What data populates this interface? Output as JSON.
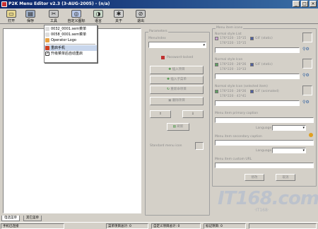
{
  "window": {
    "title": "P2K Menu Editor v2.3 (3-AUG-2005) - (n/a)",
    "min": "_",
    "max": "□",
    "close": "×"
  },
  "toolbar": {
    "open": "打开",
    "save": "保存",
    "tools": "工具",
    "custom_icon": "自定义图标",
    "language": "语言",
    "about": "关于",
    "exit": "退出"
  },
  "tools_menu": {
    "items": [
      "0032_0001.sem菜单",
      "0058_0001.sem菜单",
      "Operator Logo",
      "重启手机",
      "升级菜单后自动重启"
    ]
  },
  "params": {
    "title": "Parameters",
    "menu_index": "MenuIndex",
    "password": "Password-locked",
    "insert_item": "插入项目",
    "insert_submenu": "插入子菜单",
    "rename_item": "重新命项目",
    "delete_item": "删除项目",
    "up": "⇧",
    "down": "⇩",
    "sort": "刷新",
    "std_icon": "Standard menu icon"
  },
  "icons": {
    "title": "Menu item icons",
    "normal": "Normal style List",
    "n1": "176*220 · 15*15",
    "n2": "176*220 · 15*15",
    "n_gif": "GIF (static)",
    "sel_list": "Normal style Icon",
    "s1": "176*220 · 26*26",
    "s2": "176*220 · 33*33",
    "s_gif": "GIF (static)",
    "sel_icon": "Normal style Icon (selected item)",
    "i1": "176*220 · 26*26",
    "i2": "176*220 · 41*41",
    "i_gif": "GIF (animated)",
    "prim": "Menu item primary caption",
    "lang1": "Language",
    "sec": "Menu item secondary caption",
    "lang2": "Language",
    "url": "Menu item custom URL",
    "ok": "修改",
    "cancel": "取消"
  },
  "tabs": [
    "电话菜单",
    "其它菜单"
  ],
  "status": {
    "conn": "手机已连接",
    "menu": "菜单项目总计: 0",
    "custom": "自定义项目总计: 0",
    "mark": "标记项目: 0"
  },
  "watermark": {
    "main": "IT168.com",
    "sub": "·IT168·"
  }
}
